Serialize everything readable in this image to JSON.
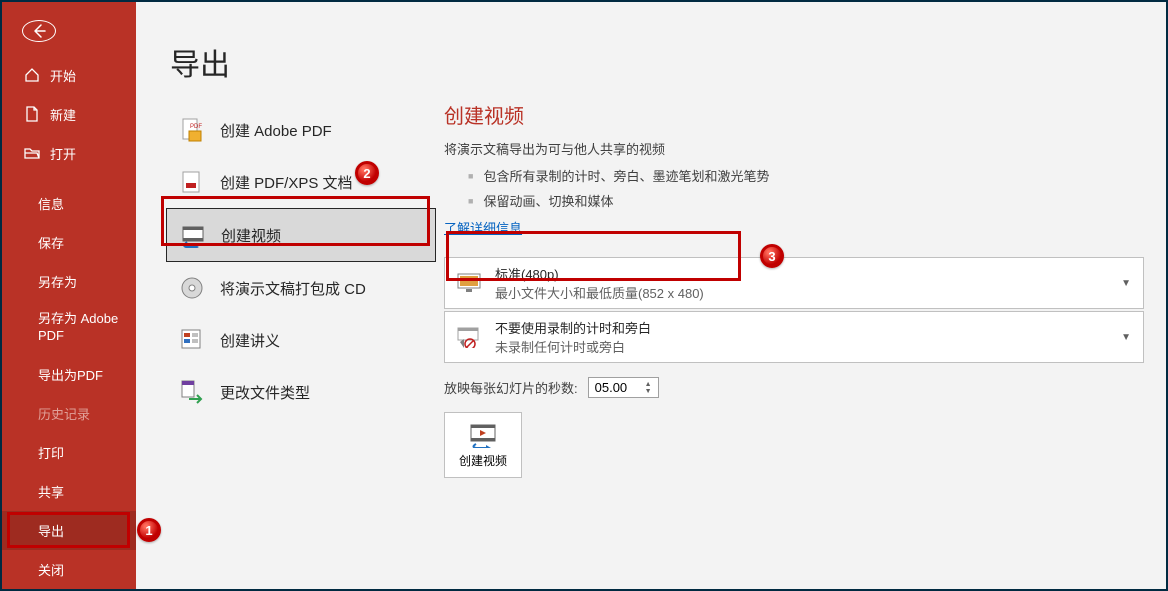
{
  "colors": {
    "brand": "#b93226",
    "callout": "#c00000"
  },
  "sidebar": {
    "items": [
      {
        "label": "开始",
        "icon": "home"
      },
      {
        "label": "新建",
        "icon": "document"
      },
      {
        "label": "打开",
        "icon": "folder-open"
      }
    ],
    "sub_items": [
      {
        "label": "信息"
      },
      {
        "label": "保存"
      },
      {
        "label": "另存为"
      },
      {
        "label": "另存为 Adobe PDF"
      },
      {
        "label": "导出为PDF"
      },
      {
        "label": "历史记录",
        "dim": true
      },
      {
        "label": "打印"
      },
      {
        "label": "共享"
      },
      {
        "label": "导出",
        "selected": true
      },
      {
        "label": "关闭"
      }
    ]
  },
  "page_title": "导出",
  "export_options": [
    {
      "label": "创建 Adobe PDF",
      "icon": "pdf"
    },
    {
      "label": "创建 PDF/XPS 文档",
      "icon": "pdfxps"
    },
    {
      "label": "创建视频",
      "icon": "video",
      "selected": true
    },
    {
      "label": "将演示文稿打包成 CD",
      "icon": "cd"
    },
    {
      "label": "创建讲义",
      "icon": "handout"
    },
    {
      "label": "更改文件类型",
      "icon": "change-type"
    }
  ],
  "detail": {
    "title": "创建视频",
    "subtitle": "将演示文稿导出为可与他人共享的视频",
    "bullets": [
      "包含所有录制的计时、旁白、墨迹笔划和激光笔势",
      "保留动画、切换和媒体"
    ],
    "link": "了解详细信息",
    "quality_dd": {
      "line1": "标准(480p)",
      "line2": "最小文件大小和最低质量(852 x 480)"
    },
    "narration_dd": {
      "line1": "不要使用录制的计时和旁白",
      "line2": "未录制任何计时或旁白"
    },
    "seconds_label": "放映每张幻灯片的秒数:",
    "seconds_value": "05.00",
    "create_button": "创建视频"
  },
  "callouts": {
    "c1": "1",
    "c2": "2",
    "c3": "3"
  }
}
